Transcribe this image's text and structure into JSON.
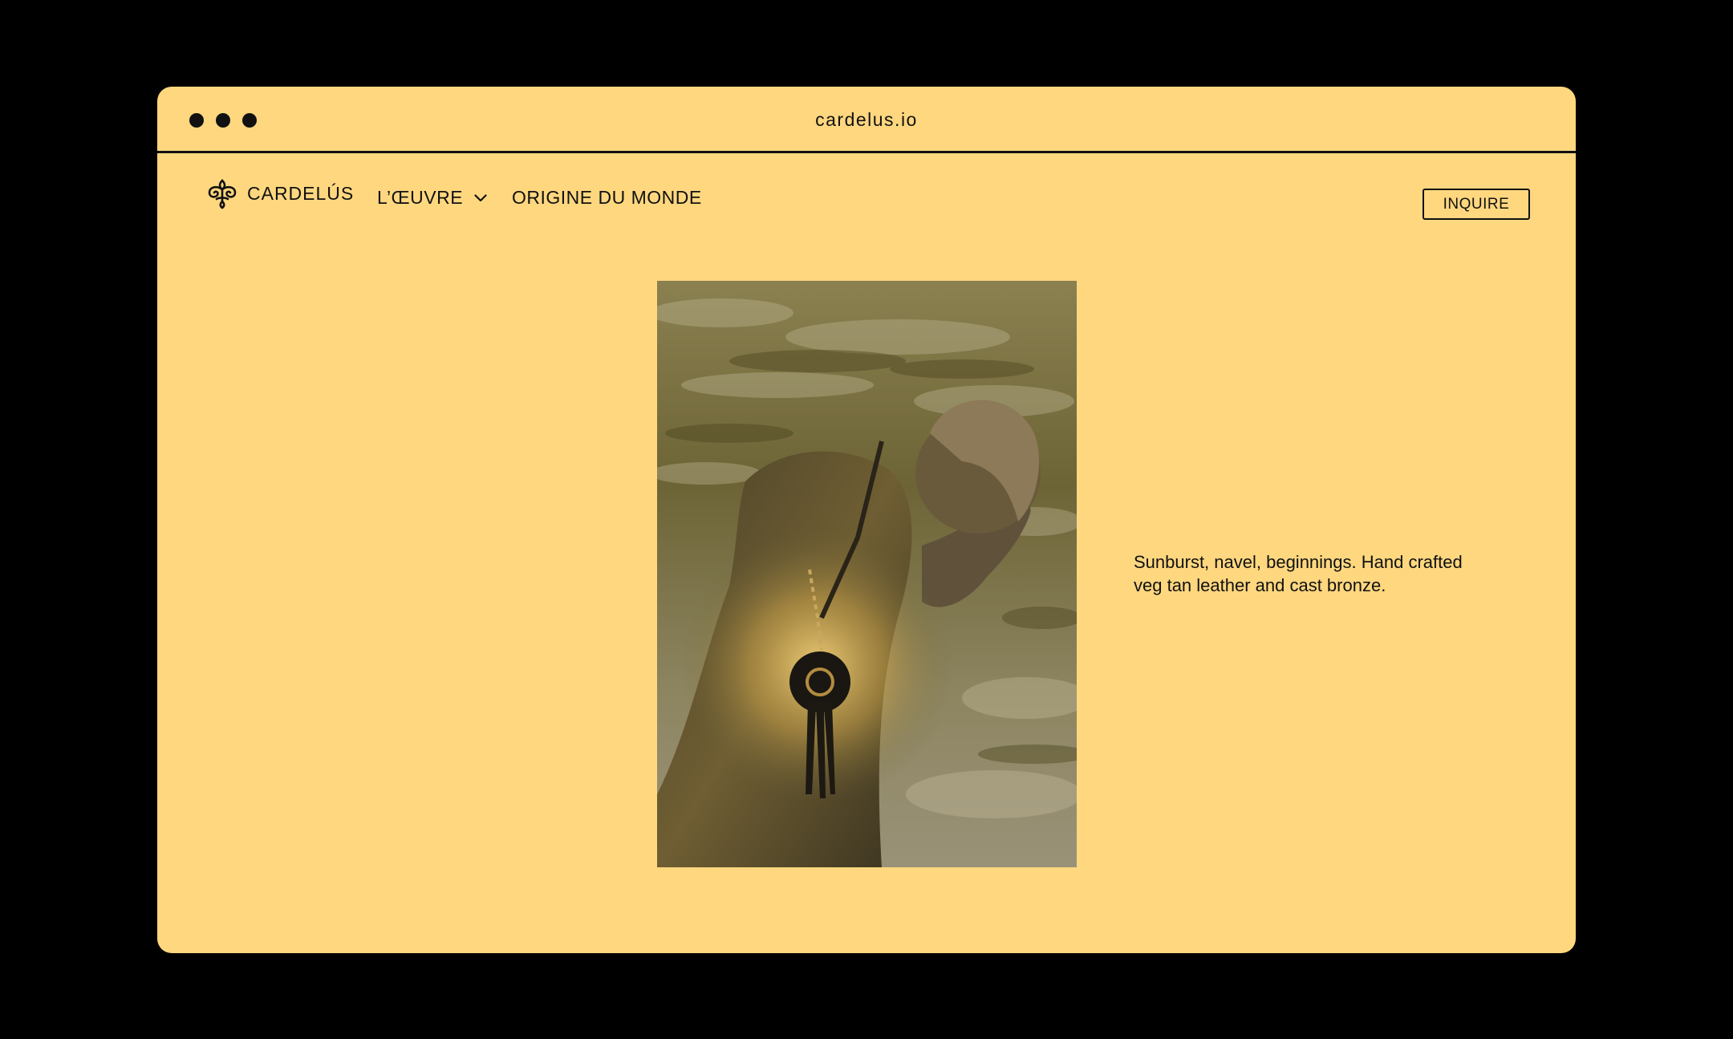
{
  "browser": {
    "url": "cardelus.io",
    "controls": [
      "close-dot",
      "minimize-dot",
      "maximize-dot"
    ]
  },
  "nav": {
    "brand": "CARDELÚS",
    "brand_icon": "fleur-logo-icon",
    "items": [
      {
        "label": "L’ŒUVRE",
        "has_dropdown": true
      },
      {
        "label": "ORIGINE DU MONDE",
        "has_dropdown": false
      }
    ],
    "cta": "INQUIRE"
  },
  "main": {
    "image_subject": "model-with-leather-bronze-pendant-photo",
    "description_line1": "Sunburst, navel, beginnings. Hand crafted",
    "description_line2": "veg tan leather and cast bronze."
  },
  "colors": {
    "page_background": "#000000",
    "window_background": "#FFD77F",
    "text": "#111111"
  }
}
